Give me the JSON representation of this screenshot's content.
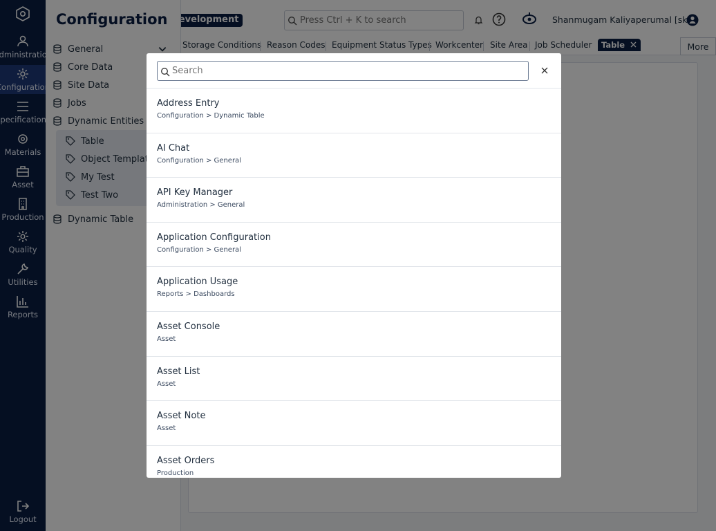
{
  "rail": {
    "items": [
      {
        "label": "Administration",
        "icon": "users-icon"
      },
      {
        "label": "Configuration",
        "icon": "gear-icon"
      },
      {
        "label": "Specifications",
        "icon": "list-icon"
      },
      {
        "label": "Materials",
        "icon": "cog-icon"
      },
      {
        "label": "Asset",
        "icon": "briefcase-icon"
      },
      {
        "label": "Production",
        "icon": "building-icon"
      },
      {
        "label": "Quality",
        "icon": "settings-icon"
      },
      {
        "label": "Utilities",
        "icon": "wrench-icon"
      },
      {
        "label": "Reports",
        "icon": "bar-chart-icon"
      }
    ],
    "logout_label": "Logout"
  },
  "sidebar": {
    "title": "Configuration",
    "items": [
      {
        "label": "General"
      },
      {
        "label": "Core Data"
      },
      {
        "label": "Site Data"
      },
      {
        "label": "Jobs"
      },
      {
        "label": "Dynamic Entities"
      }
    ],
    "sub_items": [
      {
        "label": "Table"
      },
      {
        "label": "Object Templates"
      },
      {
        "label": "My Test"
      },
      {
        "label": "Test Two"
      }
    ],
    "after_item": {
      "label": "Dynamic Table"
    }
  },
  "header": {
    "environment": "Development",
    "search_placeholder": "Press Ctrl + K to search",
    "user_name": "Shanmugam Kaliyaperumal [sk]"
  },
  "tabs": {
    "items": [
      "Storage Conditions",
      "Reason Codes",
      "Equipment Status Types",
      "Workcenter",
      "Site Area",
      "Job Scheduler"
    ],
    "active": "Table",
    "more_label": "More"
  },
  "modal": {
    "search_placeholder": "Search",
    "results": [
      {
        "name": "Address Entry",
        "path": "Configuration > Dynamic Table"
      },
      {
        "name": "AI Chat",
        "path": "Configuration > General"
      },
      {
        "name": "API Key Manager",
        "path": "Administration > General"
      },
      {
        "name": "Application Configuration",
        "path": "Configuration > General"
      },
      {
        "name": "Application Usage",
        "path": "Reports > Dashboards"
      },
      {
        "name": "Asset Console",
        "path": "Asset"
      },
      {
        "name": "Asset List",
        "path": "Asset"
      },
      {
        "name": "Asset Note",
        "path": "Asset"
      },
      {
        "name": "Asset Orders",
        "path": "Production"
      }
    ]
  },
  "colors": {
    "navy": "#0a1f44",
    "rail_active": "#1e3a7a",
    "overlay": "rgba(0,0,0,0.49)"
  }
}
